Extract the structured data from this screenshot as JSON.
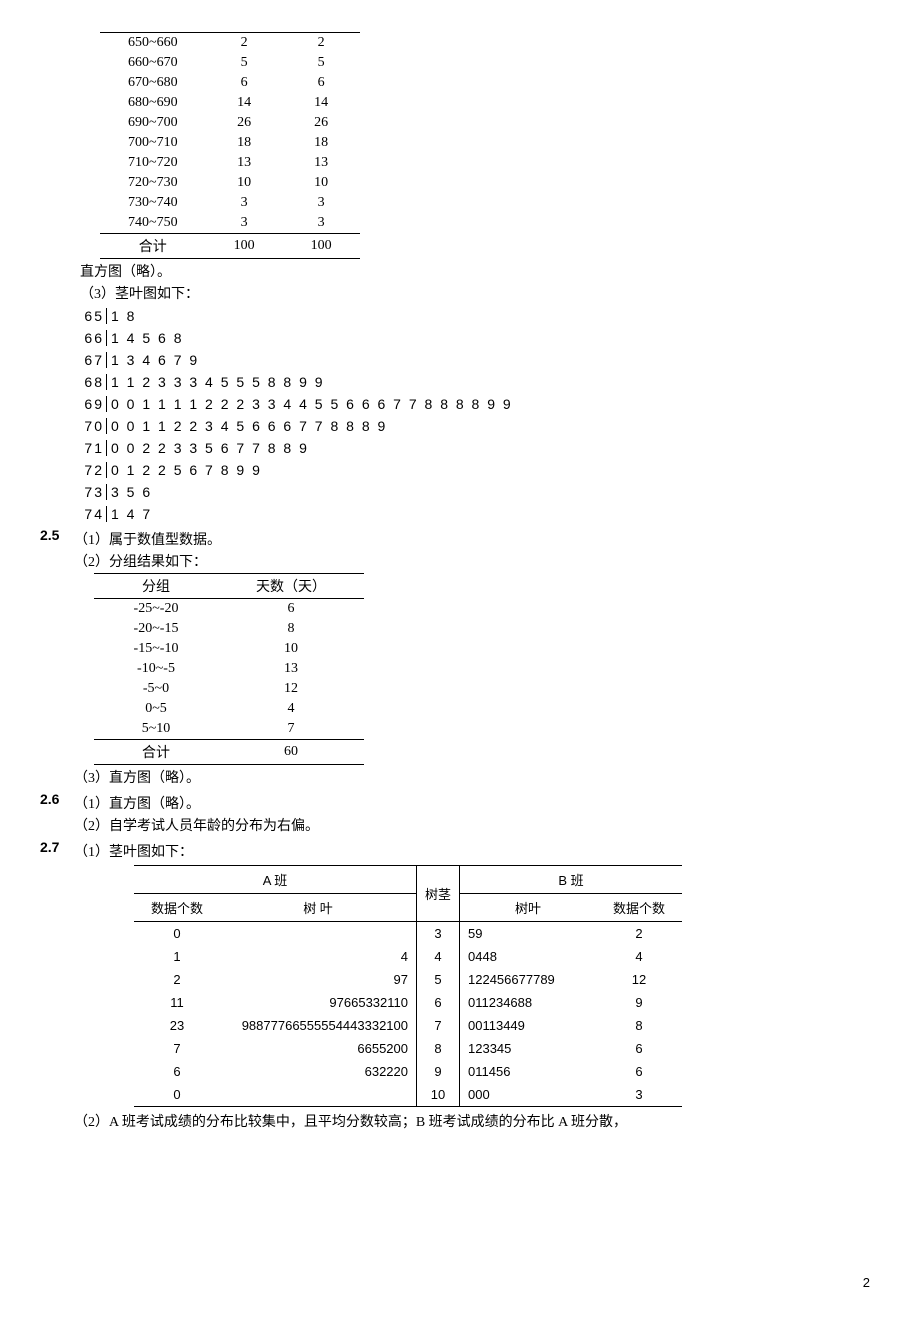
{
  "table1": {
    "rows": [
      {
        "range": "650~660",
        "f": "2",
        "p": "2"
      },
      {
        "range": "660~670",
        "f": "5",
        "p": "5"
      },
      {
        "range": "670~680",
        "f": "6",
        "p": "6"
      },
      {
        "range": "680~690",
        "f": "14",
        "p": "14"
      },
      {
        "range": "690~700",
        "f": "26",
        "p": "26"
      },
      {
        "range": "700~710",
        "f": "18",
        "p": "18"
      },
      {
        "range": "710~720",
        "f": "13",
        "p": "13"
      },
      {
        "range": "720~730",
        "f": "10",
        "p": "10"
      },
      {
        "range": "730~740",
        "f": "3",
        "p": "3"
      },
      {
        "range": "740~750",
        "f": "3",
        "p": "3"
      }
    ],
    "total_label": "合计",
    "total_f": "100",
    "total_p": "100"
  },
  "text": {
    "hist_omit": "直方图（略）。",
    "stem_intro": "（3）茎叶图如下：",
    "q25_1": "（1）属于数值型数据。",
    "q25_2": "（2）分组结果如下：",
    "q25_3": "（3）直方图（略）。",
    "q26_1": "（1）直方图（略）。",
    "q26_2": "（2）自学考试人员年龄的分布为右偏。",
    "q27_1": "（1）茎叶图如下：",
    "q27_2": "（2）A 班考试成绩的分布比较集中，且平均分数较高；B 班考试成绩的分布比 A 班分散，"
  },
  "qnum": {
    "q25": "2.5",
    "q26": "2.6",
    "q27": "2.7"
  },
  "stemleaf1": [
    {
      "stem": "65",
      "leaf": "1 8"
    },
    {
      "stem": "66",
      "leaf": "1 4 5 6 8"
    },
    {
      "stem": "67",
      "leaf": "1 3 4 6 7 9"
    },
    {
      "stem": "68",
      "leaf": "1 1 2 3 3 3 4 5 5 5 8 8 9 9"
    },
    {
      "stem": "69",
      "leaf": "0 0 1 1 1 1 2 2 2 3 3 4 4 5 5 6 6 6 7 7 8 8 8 8 9 9"
    },
    {
      "stem": "70",
      "leaf": "0 0 1 1 2 2 3 4 5 6 6 6 7 7 8 8 8 9"
    },
    {
      "stem": "71",
      "leaf": "0 0 2 2 3 3 5 6 7 7 8 8 9"
    },
    {
      "stem": "72",
      "leaf": "0 1 2 2 5 6 7 8 9 9"
    },
    {
      "stem": "73",
      "leaf": "3 5 6"
    },
    {
      "stem": "74",
      "leaf": "1 4 7"
    }
  ],
  "table2": {
    "head_group": "分组",
    "head_days": "天数（天）",
    "rows": [
      {
        "g": "-25~-20",
        "d": "6"
      },
      {
        "g": "-20~-15",
        "d": "8"
      },
      {
        "g": "-15~-10",
        "d": "10"
      },
      {
        "g": "-10~-5",
        "d": "13"
      },
      {
        "g": "-5~0",
        "d": "12"
      },
      {
        "g": "0~5",
        "d": "4"
      },
      {
        "g": "5~10",
        "d": "7"
      }
    ],
    "total_label": "合计",
    "total": "60"
  },
  "b2b": {
    "head_a": "A 班",
    "head_b": "B 班",
    "head_stem": "树茎",
    "head_count": "数据个数",
    "head_leaf": "树 叶",
    "head_leaf_b": "树叶",
    "rows": [
      {
        "ca": "0",
        "la": "",
        "s": "3",
        "lb": "59",
        "cb": "2"
      },
      {
        "ca": "1",
        "la": "4",
        "s": "4",
        "lb": "0448",
        "cb": "4"
      },
      {
        "ca": "2",
        "la": "97",
        "s": "5",
        "lb": "122456677789",
        "cb": "12"
      },
      {
        "ca": "11",
        "la": "97665332110",
        "s": "6",
        "lb": "011234688",
        "cb": "9"
      },
      {
        "ca": "23",
        "la": "98877766555554443332100",
        "s": "7",
        "lb": "00113449",
        "cb": "8"
      },
      {
        "ca": "7",
        "la": "6655200",
        "s": "8",
        "lb": "123345",
        "cb": "6"
      },
      {
        "ca": "6",
        "la": "632220",
        "s": "9",
        "lb": "011456",
        "cb": "6"
      },
      {
        "ca": "0",
        "la": "",
        "s": "10",
        "lb": "000",
        "cb": "3"
      }
    ]
  },
  "page": "2"
}
